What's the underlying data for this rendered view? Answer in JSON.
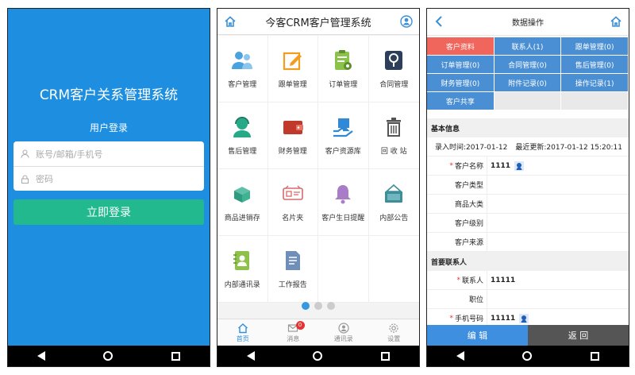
{
  "login": {
    "title": "CRM客户关系管理系统",
    "subtitle": "用户登录",
    "username_placeholder": "账号/邮箱/手机号",
    "password_placeholder": "密码",
    "login_button": "立即登录"
  },
  "app": {
    "title": "今客CRM客户管理系统",
    "modules": [
      {
        "label": "客户管理",
        "icon": "customer-icon"
      },
      {
        "label": "跟单管理",
        "icon": "edit-icon"
      },
      {
        "label": "订单管理",
        "icon": "order-icon"
      },
      {
        "label": "合同管理",
        "icon": "contract-icon"
      },
      {
        "label": "售后管理",
        "icon": "service-icon"
      },
      {
        "label": "财务管理",
        "icon": "wallet-icon"
      },
      {
        "label": "客户资源库",
        "icon": "resource-icon"
      },
      {
        "label": "回 收 站",
        "icon": "trash-icon"
      },
      {
        "label": "商品进销存",
        "icon": "box-icon"
      },
      {
        "label": "名片夹",
        "icon": "card-icon"
      },
      {
        "label": "客户生日提醒",
        "icon": "bell-icon"
      },
      {
        "label": "内部公告",
        "icon": "notice-icon"
      },
      {
        "label": "内部通讯录",
        "icon": "addressbook-icon"
      },
      {
        "label": "工作报告",
        "icon": "report-icon"
      }
    ],
    "pager": {
      "current": 1,
      "total": 3
    },
    "tabs": [
      {
        "label": "首页",
        "icon": "home-icon"
      },
      {
        "label": "消息",
        "icon": "message-icon",
        "badge": "0"
      },
      {
        "label": "通讯录",
        "icon": "contacts-icon"
      },
      {
        "label": "设置",
        "icon": "settings-icon"
      }
    ]
  },
  "ops": {
    "title": "数据操作",
    "tabs": [
      "客户资料",
      "联系人(1)",
      "跟单管理(0)",
      "订单管理(0)",
      "合同管理(0)",
      "售后管理(0)",
      "财务管理(0)",
      "附件记录(0)",
      "操作记录(1)",
      "客户共享"
    ],
    "basic_section": "基本信息",
    "created_time": "录入时间:2017-01-12",
    "updated_time": "最近更新:2017-01-12 15:20:11",
    "basic_fields": [
      {
        "label": "客户名称",
        "required": true,
        "value": "1111",
        "qq": true
      },
      {
        "label": "客户类型",
        "required": false,
        "value": ""
      },
      {
        "label": "商品大类",
        "required": false,
        "value": ""
      },
      {
        "label": "客户级别",
        "required": false,
        "value": ""
      },
      {
        "label": "客户来源",
        "required": false,
        "value": ""
      }
    ],
    "contact_section": "首要联系人",
    "contact_fields": [
      {
        "label": "联系人",
        "required": true,
        "value": "11111"
      },
      {
        "label": "职位",
        "required": false,
        "value": ""
      },
      {
        "label": "手机号码",
        "required": true,
        "value": "11111",
        "qq": true
      }
    ],
    "edit_button": "编 辑",
    "back_button": "返 回",
    "colors": {
      "tab_blue": "#4a8fd4",
      "tab_selected": "#f0665c",
      "edit_blue": "#3f8fe0"
    }
  }
}
